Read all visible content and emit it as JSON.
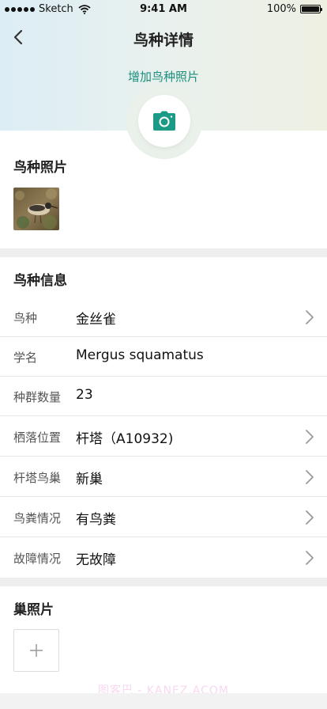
{
  "status_bar": {
    "carrier": "Sketch",
    "time": "9:41 AM",
    "battery": "100%"
  },
  "nav": {
    "title": "鸟种详情",
    "back_icon": "chevron-left-icon"
  },
  "header": {
    "add_photo_label": "增加鸟种照片",
    "camera_icon": "camera-icon",
    "accent_color": "#1b9a85"
  },
  "photos_section": {
    "title": "鸟种照片"
  },
  "info_section": {
    "title": "鸟种信息",
    "rows": [
      {
        "label": "鸟种",
        "value": "金丝雀",
        "has_arrow": true
      },
      {
        "label": "学名",
        "value": "Mergus squamatus",
        "has_arrow": false
      },
      {
        "label": "种群数量",
        "value": "23",
        "has_arrow": false
      },
      {
        "label": "栖落位置",
        "value": "杆塔（A10932)",
        "has_arrow": true
      },
      {
        "label": "杆塔鸟巢",
        "value": "新巢",
        "has_arrow": true
      },
      {
        "label": "鸟粪情况",
        "value": "有鸟粪",
        "has_arrow": true
      },
      {
        "label": "故障情况",
        "value": "无故障",
        "has_arrow": true
      }
    ]
  },
  "nest_section": {
    "title": "巢照片",
    "add_icon": "plus-icon"
  },
  "watermark": "图客巴 - KANEZ.ACOM"
}
